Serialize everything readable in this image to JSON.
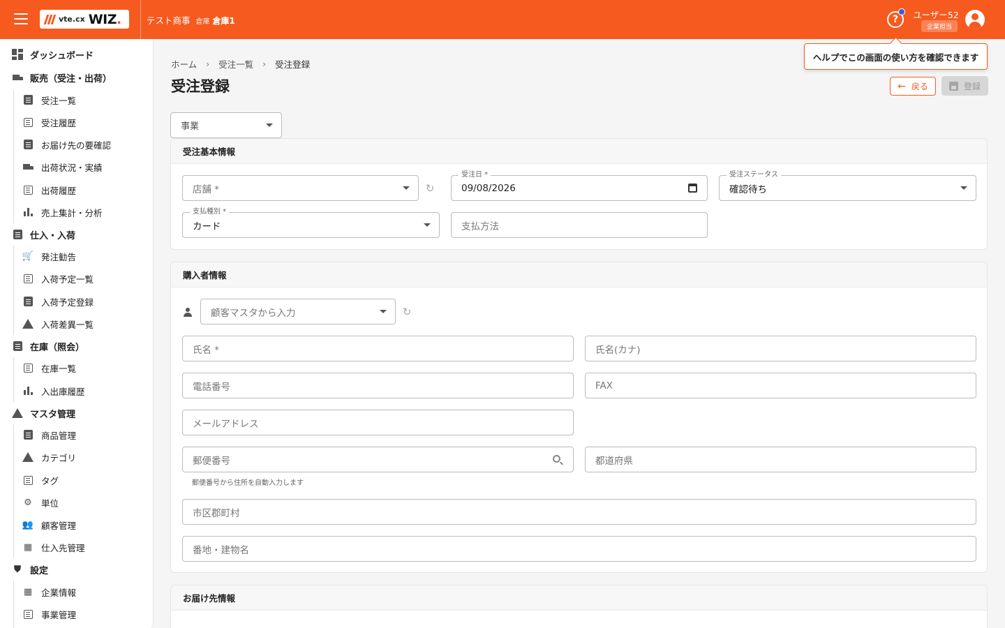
{
  "header": {
    "logo_vte": "vte.cx",
    "logo_wiz": "WIZ",
    "logo_dot": ".",
    "company": "テスト商事",
    "warehouse_label": "倉庫",
    "warehouse_name": "倉庫1",
    "user_name": "ユーザー52",
    "user_role": "企業担当",
    "help_glyph": "?",
    "accent_color": "#f75a1e"
  },
  "tooltip": "ヘルプでこの画面の使い方を確認できます",
  "sidebar": {
    "dashboard": "ダッシュボード",
    "sales": "販売（受注・出荷）",
    "sales_items": [
      "受注一覧",
      "受注履歴",
      "お届け先の要確認",
      "出荷状況・実績",
      "出荷履歴",
      "売上集計・分析"
    ],
    "purchase": "仕入・入荷",
    "purchase_items": [
      "発注勧告",
      "入荷予定一覧",
      "入荷予定登録",
      "入荷差異一覧"
    ],
    "inventory": "在庫（照会）",
    "inventory_items": [
      "在庫一覧",
      "入出庫履歴"
    ],
    "master": "マスタ管理",
    "master_items": [
      "商品管理",
      "カテゴリ",
      "タグ",
      "単位",
      "顧客管理",
      "仕入先管理"
    ],
    "settings": "設定",
    "settings_items": [
      "企業情報",
      "事業管理"
    ]
  },
  "breadcrumb": [
    "ホーム",
    "受注一覧",
    "受注登録"
  ],
  "breadcrumb_sep": "›",
  "page_title": "受注登録",
  "buttons": {
    "back": "戻る",
    "register": "登録"
  },
  "business_select": "事業",
  "order_basic": {
    "title": "受注基本情報",
    "store_placeholder": "店舗 *",
    "order_date_label": "受注日 *",
    "order_date": "09/08/2026",
    "status_label": "受注ステータス",
    "status_value": "確認待ち",
    "payment_type_label": "支払種別 *",
    "payment_type_value": "カード",
    "payment_method_placeholder": "支払方法"
  },
  "buyer": {
    "title": "購入者情報",
    "customer_master_placeholder": "顧客マスタから入力",
    "name_placeholder": "氏名 *",
    "kana_placeholder": "氏名(カナ)",
    "phone_placeholder": "電話番号",
    "fax_placeholder": "FAX",
    "email_placeholder": "メールアドレス",
    "zip_placeholder": "郵便番号",
    "zip_helper": "郵便番号から住所を自動入力します",
    "prefecture_placeholder": "都道府県",
    "city_placeholder": "市区郡町村",
    "address_placeholder": "番地・建物名"
  },
  "delivery": {
    "title": "お届け先情報"
  }
}
